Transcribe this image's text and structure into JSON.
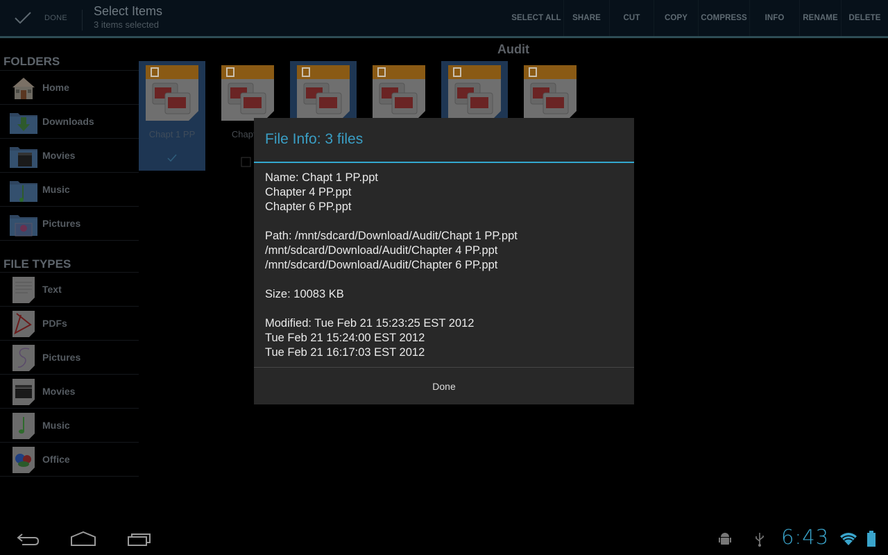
{
  "action_bar": {
    "done_label": "DONE",
    "title": "Select Items",
    "subtitle": "3 items selected",
    "actions": [
      {
        "label": "SELECT ALL",
        "name": "select-all-button"
      },
      {
        "label": "SHARE",
        "name": "share-button"
      },
      {
        "label": "CUT",
        "name": "cut-button"
      },
      {
        "label": "COPY",
        "name": "copy-button"
      },
      {
        "label": "COMPRESS",
        "name": "compress-button"
      },
      {
        "label": "INFO",
        "name": "info-button"
      },
      {
        "label": "RENAME",
        "name": "rename-button"
      },
      {
        "label": "DELETE",
        "name": "delete-button"
      }
    ]
  },
  "sidebar": {
    "folders_header": "FOLDERS",
    "folders": [
      {
        "label": "Home",
        "icon": "home-icon"
      },
      {
        "label": "Downloads",
        "icon": "downloads-folder-icon"
      },
      {
        "label": "Movies",
        "icon": "movies-folder-icon"
      },
      {
        "label": "Music",
        "icon": "music-folder-icon"
      },
      {
        "label": "Pictures",
        "icon": "pictures-folder-icon"
      }
    ],
    "file_types_header": "FILE TYPES",
    "file_types": [
      {
        "label": "Text",
        "icon": "text-file-icon"
      },
      {
        "label": "PDFs",
        "icon": "pdf-file-icon"
      },
      {
        "label": "Pictures",
        "icon": "picture-file-icon"
      },
      {
        "label": "Movies",
        "icon": "movie-file-icon"
      },
      {
        "label": "Music",
        "icon": "music-file-icon"
      },
      {
        "label": "Office",
        "icon": "office-file-icon"
      }
    ]
  },
  "main": {
    "folder_title": "Audit",
    "files": [
      {
        "label": "Chapt 1 PP",
        "selected": true
      },
      {
        "label": "Chapter",
        "selected": false
      },
      {
        "label": "",
        "selected": true
      },
      {
        "label": "",
        "selected": false
      },
      {
        "label": "",
        "selected": true
      },
      {
        "label": "",
        "selected": false
      }
    ]
  },
  "dialog": {
    "title": "File Info: 3 files",
    "name_lines": [
      "Name: Chapt 1 PP.ppt",
      "Chapter 4 PP.ppt",
      "Chapter 6 PP.ppt"
    ],
    "path_lines": [
      "Path: /mnt/sdcard/Download/Audit/Chapt 1 PP.ppt",
      "/mnt/sdcard/Download/Audit/Chapter 4 PP.ppt",
      "/mnt/sdcard/Download/Audit/Chapter 6 PP.ppt"
    ],
    "size_line": "Size: 10083 KB",
    "modified_lines": [
      "Modified: Tue Feb 21 15:23:25 EST 2012",
      "Tue Feb 21 15:24:00 EST 2012",
      "Tue Feb 21 16:17:03 EST 2012"
    ],
    "done_label": "Done"
  },
  "status": {
    "time": "6:43"
  },
  "colors": {
    "accent": "#33a7cf",
    "selected_tile": "#1e3653"
  }
}
